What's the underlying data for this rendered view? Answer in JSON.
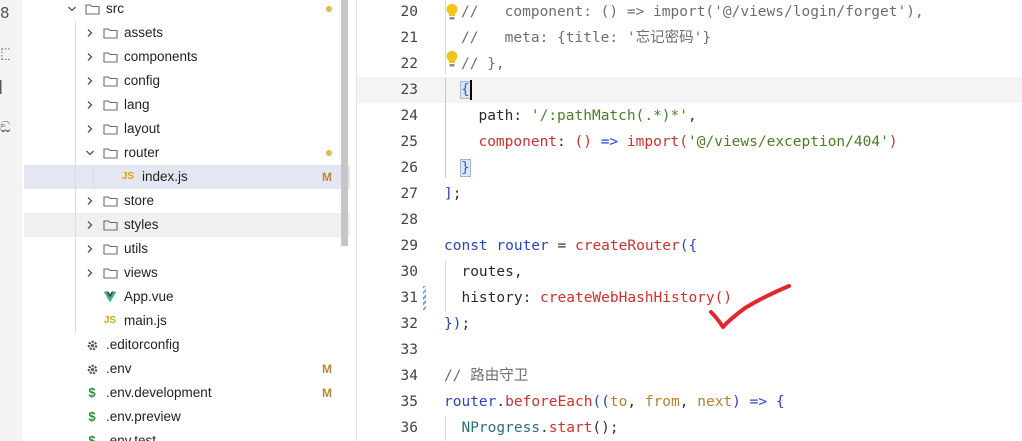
{
  "explorer": {
    "items": [
      {
        "label": "src",
        "kind": "folder",
        "expanded": true,
        "depth": 0,
        "status": "dot"
      },
      {
        "label": "assets",
        "kind": "folder",
        "expanded": false,
        "depth": 1
      },
      {
        "label": "components",
        "kind": "folder",
        "expanded": false,
        "depth": 1
      },
      {
        "label": "config",
        "kind": "folder",
        "expanded": false,
        "depth": 1
      },
      {
        "label": "lang",
        "kind": "folder",
        "expanded": false,
        "depth": 1
      },
      {
        "label": "layout",
        "kind": "folder",
        "expanded": false,
        "depth": 1
      },
      {
        "label": "router",
        "kind": "folder",
        "expanded": true,
        "depth": 1,
        "status": "dot"
      },
      {
        "label": "index.js",
        "kind": "js",
        "depth": 2,
        "status": "M",
        "selected": true
      },
      {
        "label": "store",
        "kind": "folder",
        "expanded": false,
        "depth": 1
      },
      {
        "label": "styles",
        "kind": "folder",
        "expanded": false,
        "depth": 1,
        "hover": true
      },
      {
        "label": "utils",
        "kind": "folder",
        "expanded": false,
        "depth": 1
      },
      {
        "label": "views",
        "kind": "folder",
        "expanded": false,
        "depth": 1
      },
      {
        "label": "App.vue",
        "kind": "vue",
        "depth": 1
      },
      {
        "label": "main.js",
        "kind": "js",
        "depth": 1
      },
      {
        "label": ".editorconfig",
        "kind": "gear",
        "depth": 0
      },
      {
        "label": ".env",
        "kind": "gear",
        "depth": 0,
        "status": "M"
      },
      {
        "label": ".env.development",
        "kind": "env",
        "depth": 0,
        "status": "M"
      },
      {
        "label": ".env.preview",
        "kind": "env",
        "depth": 0
      },
      {
        "label": ".env.test",
        "kind": "env",
        "depth": 0
      }
    ],
    "js_badge": "JS",
    "env_badge": "$"
  },
  "activity": {
    "glyphs": [
      "8",
      "⬚",
      "▏",
      "ඞ"
    ]
  },
  "editor": {
    "lines": [
      {
        "num": "20",
        "tokens": [
          [
            "comment",
            "//   component: () => import('@/views/login/forget'),"
          ]
        ]
      },
      {
        "num": "21",
        "tokens": [
          [
            "comment",
            "//   meta: {title: '忘记密码'}"
          ]
        ]
      },
      {
        "num": "22",
        "tokens": [
          [
            "comment",
            "// },"
          ]
        ]
      },
      {
        "num": "23",
        "tokens": [
          [
            "brace",
            "{"
          ]
        ]
      },
      {
        "num": "24",
        "tokens": [
          [
            "prop",
            "  path"
          ],
          [
            "punct",
            ": "
          ],
          [
            "str",
            "'/:pathMatch(.*)*'"
          ],
          [
            "punct",
            ","
          ]
        ]
      },
      {
        "num": "25",
        "tokens": [
          [
            "fn",
            "  component"
          ],
          [
            "punct",
            ": "
          ],
          [
            "fn",
            "()"
          ],
          [
            "punct",
            " "
          ],
          [
            "kw",
            "=>"
          ],
          [
            "punct",
            " "
          ],
          [
            "fn",
            "import"
          ],
          [
            "fn",
            "("
          ],
          [
            "str",
            "'@/views/exception/404'"
          ],
          [
            "fn",
            ")"
          ]
        ]
      },
      {
        "num": "26",
        "tokens": [
          [
            "brace",
            "}"
          ]
        ]
      },
      {
        "num": "27",
        "tokens": [
          [
            "kw",
            "]"
          ],
          [
            "punct",
            ";"
          ]
        ]
      },
      {
        "num": "28",
        "tokens": []
      },
      {
        "num": "29",
        "tokens": [
          [
            "kw",
            "const"
          ],
          [
            "punct",
            " "
          ],
          [
            "kw",
            "router"
          ],
          [
            "punct",
            " = "
          ],
          [
            "fn",
            "createRouter"
          ],
          [
            "kw",
            "({"
          ]
        ]
      },
      {
        "num": "30",
        "tokens": [
          [
            "prop",
            "  routes"
          ],
          [
            "punct",
            ","
          ]
        ]
      },
      {
        "num": "31",
        "tokens": [
          [
            "prop",
            "  history"
          ],
          [
            "punct",
            ": "
          ],
          [
            "fn",
            "createWebHashHistory"
          ],
          [
            "fn",
            "()"
          ]
        ]
      },
      {
        "num": "32",
        "tokens": [
          [
            "kw",
            "})"
          ],
          [
            "punct",
            ";"
          ]
        ]
      },
      {
        "num": "33",
        "tokens": []
      },
      {
        "num": "34",
        "tokens": [
          [
            "comment",
            "// 路由守卫"
          ]
        ]
      },
      {
        "num": "35",
        "tokens": [
          [
            "kw",
            "router"
          ],
          [
            "punct",
            "."
          ],
          [
            "fn",
            "beforeEach"
          ],
          [
            "kw",
            "(("
          ],
          [
            "param",
            "to"
          ],
          [
            "punct",
            ", "
          ],
          [
            "param",
            "from"
          ],
          [
            "punct",
            ", "
          ],
          [
            "param",
            "next"
          ],
          [
            "kw",
            ")"
          ],
          [
            "punct",
            " "
          ],
          [
            "kw",
            "=>"
          ],
          [
            "punct",
            " "
          ],
          [
            "kw",
            "{"
          ]
        ]
      },
      {
        "num": "36",
        "tokens": [
          [
            "obj",
            "  NProgress"
          ],
          [
            "punct",
            "."
          ],
          [
            "fn",
            "start"
          ],
          [
            "punct",
            "();"
          ]
        ]
      }
    ],
    "current_line": "23"
  },
  "colors": {
    "accent": "#2b43c6",
    "annotation": "#e3262b",
    "modified": "#b8893a"
  }
}
